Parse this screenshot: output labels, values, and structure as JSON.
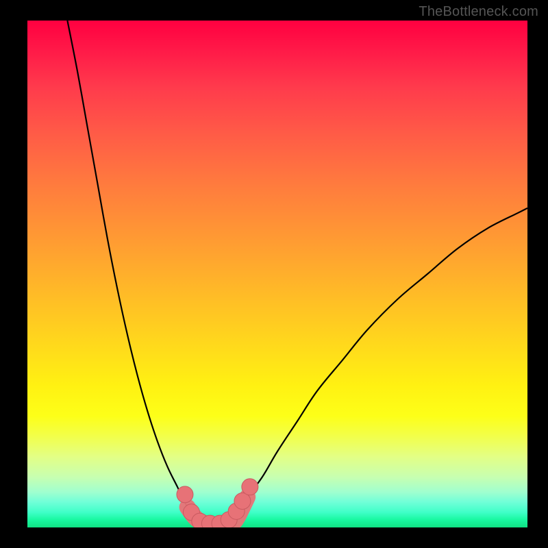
{
  "watermark": "TheBottleneck.com",
  "colors": {
    "curve": "#000000",
    "marker_fill": "#e77277",
    "marker_stroke": "#c95a60",
    "background_frame": "#000000"
  },
  "chart_data": {
    "type": "line",
    "title": "",
    "xlabel": "",
    "ylabel": "",
    "xlim": [
      0,
      100
    ],
    "ylim": [
      0,
      100
    ],
    "note": "Bottleneck-style V-curve. x = relative component scale, y = bottleneck percentage (0% = green/optimal at the valley, 100% = red/severe).",
    "series": [
      {
        "name": "left-branch",
        "x": [
          8,
          10,
          12,
          14,
          16,
          18,
          20,
          22,
          24,
          26,
          28,
          30,
          32,
          33.5
        ],
        "values": [
          100,
          90,
          79,
          68,
          57,
          47,
          38,
          30,
          23,
          17,
          12,
          8,
          4,
          2
        ]
      },
      {
        "name": "right-branch",
        "x": [
          42,
          44,
          47,
          50,
          54,
          58,
          63,
          68,
          74,
          80,
          86,
          92,
          98,
          100
        ],
        "values": [
          3,
          6,
          10,
          15,
          21,
          27,
          33,
          39,
          45,
          50,
          55,
          59,
          62,
          63
        ]
      },
      {
        "name": "valley-floor",
        "x": [
          33.5,
          35,
          37,
          39,
          41,
          42
        ],
        "values": [
          2,
          1,
          0.5,
          0.5,
          1,
          2
        ]
      }
    ],
    "markers": {
      "name": "highlighted-points",
      "points": [
        {
          "x": 31.5,
          "y": 6.5
        },
        {
          "x": 32.8,
          "y": 3.0
        },
        {
          "x": 34.5,
          "y": 1.2
        },
        {
          "x": 36.5,
          "y": 0.8
        },
        {
          "x": 38.5,
          "y": 0.8
        },
        {
          "x": 40.3,
          "y": 1.5
        },
        {
          "x": 41.8,
          "y": 3.2
        },
        {
          "x": 43.0,
          "y": 5.2
        },
        {
          "x": 44.5,
          "y": 8.0
        }
      ]
    }
  }
}
